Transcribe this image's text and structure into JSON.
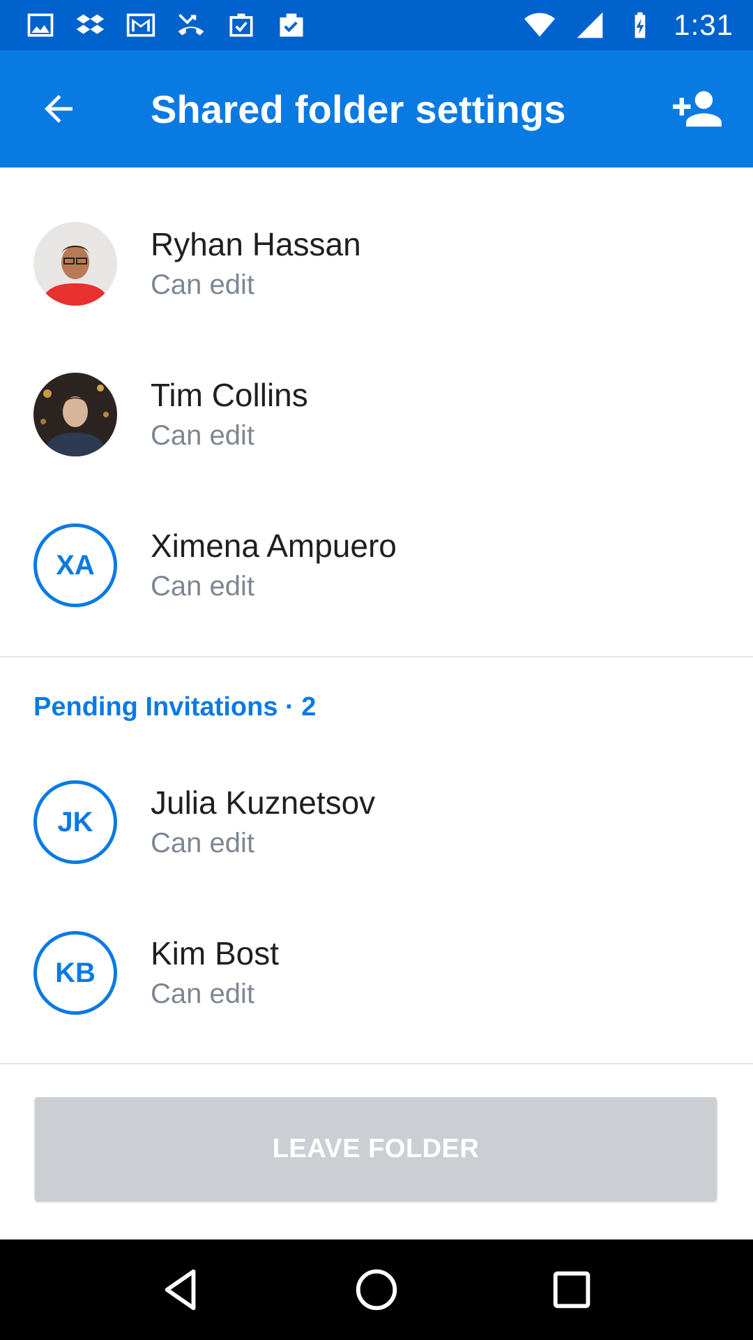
{
  "status_bar": {
    "time": "1:31",
    "left_icons": [
      "image-icon",
      "dropbox-icon",
      "gmail-icon",
      "missed-call-icon",
      "task-icon",
      "briefcase-check-icon"
    ],
    "right_icons": [
      "wifi-icon",
      "signal-icon",
      "battery-charging-icon"
    ]
  },
  "app_bar": {
    "title": "Shared folder settings",
    "back_icon": "arrow-back-icon",
    "action_icon": "add-person-icon",
    "color": "#0a7ae3"
  },
  "members": [
    {
      "name": "Ryhan Hassan",
      "role": "Can edit",
      "avatar": "photo"
    },
    {
      "name": "Tim Collins",
      "role": "Can edit",
      "avatar": "photo"
    },
    {
      "name": "Ximena Ampuero",
      "role": "Can edit",
      "avatar": "initials",
      "initials": "XA"
    }
  ],
  "pending": {
    "header": "Pending Invitations · 2",
    "invitees": [
      {
        "name": "Julia Kuznetsov",
        "role": "Can edit",
        "initials": "JK"
      },
      {
        "name": "Kim Bost",
        "role": "Can edit",
        "initials": "KB"
      }
    ]
  },
  "leave_button": {
    "label": "LEAVE FOLDER"
  },
  "nav_bar": {
    "icons": [
      "back-triangle-icon",
      "home-circle-icon",
      "recents-square-icon"
    ]
  }
}
